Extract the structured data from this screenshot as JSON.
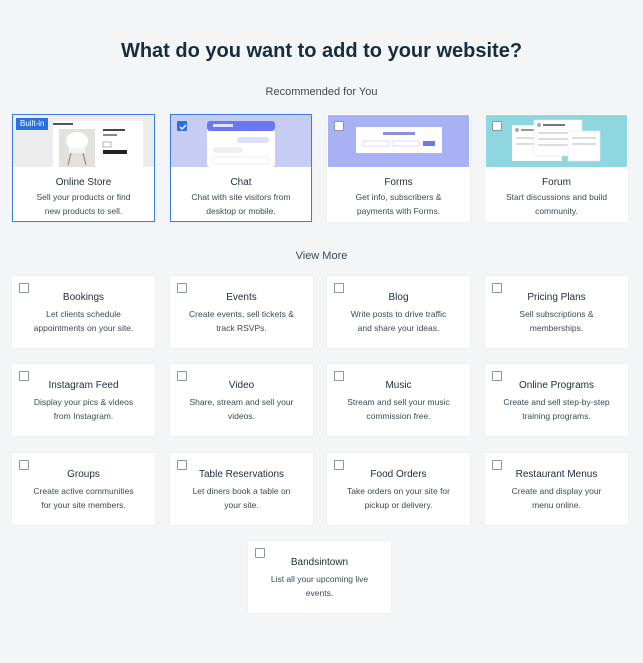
{
  "header": {
    "title": "What do you want to add to your website?"
  },
  "sections": {
    "recommended": "Recommended for You",
    "view_more": "View More"
  },
  "colors": {
    "accent": "#2b6fe0",
    "background": "#f4f5f7"
  },
  "recommended": [
    {
      "name": "Online Store",
      "desc1": "Sell your products or find",
      "desc2": "new products to sell.",
      "badge": "Built-in",
      "checked": true,
      "image": "product-store-preview"
    },
    {
      "name": "Chat",
      "desc1": "Chat with site visitors from",
      "desc2": "desktop or mobile.",
      "checked": true,
      "image": "chat-preview"
    },
    {
      "name": "Forms",
      "desc1": "Get info, subscribers &",
      "desc2": "payments with Forms.",
      "checked": false,
      "image": "form-preview"
    },
    {
      "name": "Forum",
      "desc1": "Start discussions and build",
      "desc2": "community.",
      "checked": false,
      "image": "forum-preview"
    }
  ],
  "more": [
    {
      "name": "Bookings",
      "desc1": "Let clients schedule",
      "desc2": "appointments on your site."
    },
    {
      "name": "Events",
      "desc1": "Create events, sell tickets &",
      "desc2": "track RSVPs."
    },
    {
      "name": "Blog",
      "desc1": "Write posts to drive traffic",
      "desc2": "and share your ideas."
    },
    {
      "name": "Pricing Plans",
      "desc1": "Sell subscriptions &",
      "desc2": "memberships."
    },
    {
      "name": "Instagram Feed",
      "desc1": "Display your pics & videos",
      "desc2": "from Instagram."
    },
    {
      "name": "Video",
      "desc1": "Share, stream and sell your",
      "desc2": "videos."
    },
    {
      "name": "Music",
      "desc1": "Stream and sell your music",
      "desc2": "commission free."
    },
    {
      "name": "Online Programs",
      "desc1": "Create and sell step-by-step",
      "desc2": "training programs."
    },
    {
      "name": "Groups",
      "desc1": "Create active communities",
      "desc2": "for your site members."
    },
    {
      "name": "Table Reservations",
      "desc1": "Let diners book a table on",
      "desc2": "your site."
    },
    {
      "name": "Food Orders",
      "desc1": "Take orders on your site for",
      "desc2": "pickup or delivery."
    },
    {
      "name": "Restaurant Menus",
      "desc1": "Create and display your",
      "desc2": "menu online."
    },
    {
      "name": "Bandsintown",
      "desc1": "List all your upcoming live",
      "desc2": "events."
    }
  ]
}
